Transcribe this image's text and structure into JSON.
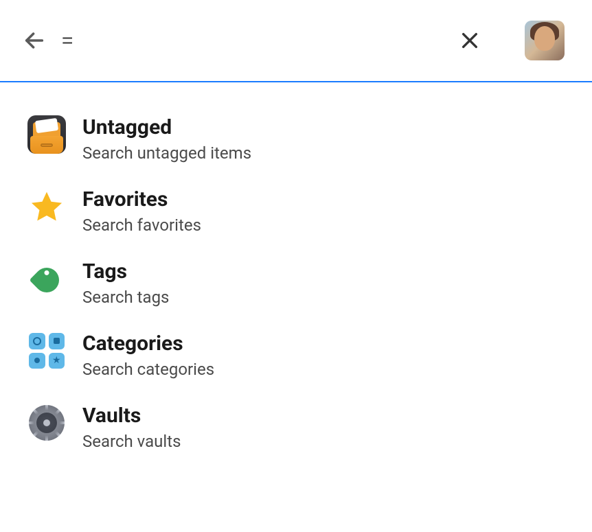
{
  "search": {
    "value": "=",
    "placeholder": ""
  },
  "results": [
    {
      "title": "Untagged",
      "subtitle": "Search untagged items",
      "icon": "drawer"
    },
    {
      "title": "Favorites",
      "subtitle": "Search favorites",
      "icon": "star"
    },
    {
      "title": "Tags",
      "subtitle": "Search tags",
      "icon": "tag"
    },
    {
      "title": "Categories",
      "subtitle": "Search categories",
      "icon": "categories"
    },
    {
      "title": "Vaults",
      "subtitle": "Search vaults",
      "icon": "vault"
    }
  ]
}
